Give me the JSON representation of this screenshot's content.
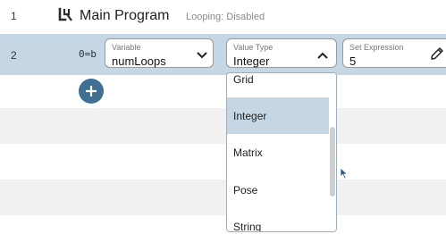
{
  "program": {
    "line_number": "1",
    "title": "Main Program",
    "looping_label": "Looping:",
    "looping_value": "Disabled"
  },
  "step": {
    "line_number": "2",
    "type_symbol": "0=b",
    "variable": {
      "label": "Variable",
      "value": "numLoops"
    },
    "value_type": {
      "label": "Value Type",
      "value": "Integer"
    },
    "expression": {
      "label": "Set Expression",
      "value": "5"
    }
  },
  "dropdown": {
    "options": [
      "Grid",
      "Integer",
      "Matrix",
      "Pose",
      "String"
    ],
    "selected": "Integer"
  },
  "icons": {
    "program": "program-icon",
    "add": "plus-icon",
    "edit": "pencil-icon",
    "variable_chevron": "chevron-down-icon",
    "type_chevron": "chevron-up-icon",
    "cursor": "mouse-cursor-icon"
  },
  "colors": {
    "selected_row": "#c5d6e4",
    "add_button": "#3f6f93",
    "stripe": "#f1f1f1"
  }
}
